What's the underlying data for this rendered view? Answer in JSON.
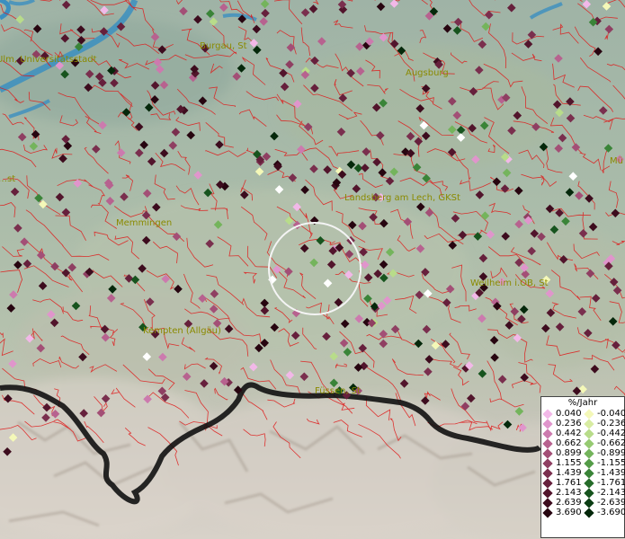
{
  "cities": [
    {
      "label": "Ulm, Universitätsstadt"
    },
    {
      "label": "Burgau, St"
    },
    {
      "label": "Augsburg"
    },
    {
      "label": "Mü"
    },
    {
      "label": "Landsberg am Lech, GKSt"
    },
    {
      "label": "Memmingen"
    },
    {
      "label": "Weilheim i.OB, St"
    },
    {
      "label": "Kempten (Allgäu)"
    },
    {
      "label": "Füssen, St"
    },
    {
      "label": "…st"
    }
  ],
  "legend": {
    "title": "%/Jahr",
    "positive": [
      {
        "value": "0.040",
        "color": "#f2b8e8"
      },
      {
        "value": "0.236",
        "color": "#e095cc"
      },
      {
        "value": "0.442",
        "color": "#cc7aae"
      },
      {
        "value": "0.662",
        "color": "#b7628f"
      },
      {
        "value": "0.899",
        "color": "#a34f76"
      },
      {
        "value": "1.155",
        "color": "#8f3f62"
      },
      {
        "value": "1.439",
        "color": "#7a2f4e"
      },
      {
        "value": "1.761",
        "color": "#66203c"
      },
      {
        "value": "2.143",
        "color": "#52152c"
      },
      {
        "value": "2.639",
        "color": "#3d0c1e"
      },
      {
        "value": "3.690",
        "color": "#270510"
      }
    ],
    "negative": [
      {
        "value": "-0.040",
        "color": "#f4f8b8"
      },
      {
        "value": "-0.236",
        "color": "#d8eca2"
      },
      {
        "value": "-0.442",
        "color": "#b8dc8a"
      },
      {
        "value": "-0.662",
        "color": "#96ca72"
      },
      {
        "value": "-0.899",
        "color": "#74b45c"
      },
      {
        "value": "-1.155",
        "color": "#549c48"
      },
      {
        "value": "-1.439",
        "color": "#3a8438"
      },
      {
        "value": "-1.761",
        "color": "#266c2a"
      },
      {
        "value": "-2.143",
        "color": "#17541e"
      },
      {
        "value": "-2.639",
        "color": "#0c3e14"
      },
      {
        "value": "-3.690",
        "color": "#05280b"
      }
    ]
  },
  "colors": {
    "boundary": "#e01818",
    "river": "#3b8fc0",
    "border": "#111111",
    "circle": "#f4f4f4"
  }
}
